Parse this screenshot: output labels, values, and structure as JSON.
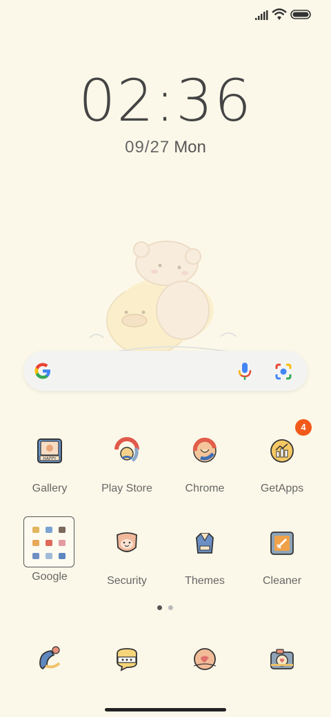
{
  "status_bar": {
    "icons": [
      "signal-icon",
      "wifi-icon",
      "battery-icon"
    ]
  },
  "clock": {
    "time": "02:36",
    "date": "09/27",
    "day": "Mon"
  },
  "search_bar": {
    "icons": [
      "google-g-icon",
      "mic-icon",
      "lens-icon"
    ]
  },
  "apps": [
    {
      "label": "Gallery",
      "icon": "gallery-icon"
    },
    {
      "label": "Play Store",
      "icon": "play-store-icon"
    },
    {
      "label": "Chrome",
      "icon": "chrome-icon"
    },
    {
      "label": "GetApps",
      "icon": "getapps-icon",
      "badge": "4"
    },
    {
      "label": "Google",
      "icon": "google-folder-icon"
    },
    {
      "label": "Security",
      "icon": "security-icon"
    },
    {
      "label": "Themes",
      "icon": "themes-icon"
    },
    {
      "label": "Cleaner",
      "icon": "cleaner-icon"
    }
  ],
  "gallery_icon_text": "HAPPY",
  "pager": {
    "count": 2,
    "active": 1
  },
  "dock": [
    {
      "icon": "phone-icon"
    },
    {
      "icon": "messages-icon"
    },
    {
      "icon": "browser-icon"
    },
    {
      "icon": "camera-icon"
    }
  ],
  "colors": {
    "background": "#fcf8e9",
    "badge": "#f15a1a",
    "text": "#666666"
  }
}
